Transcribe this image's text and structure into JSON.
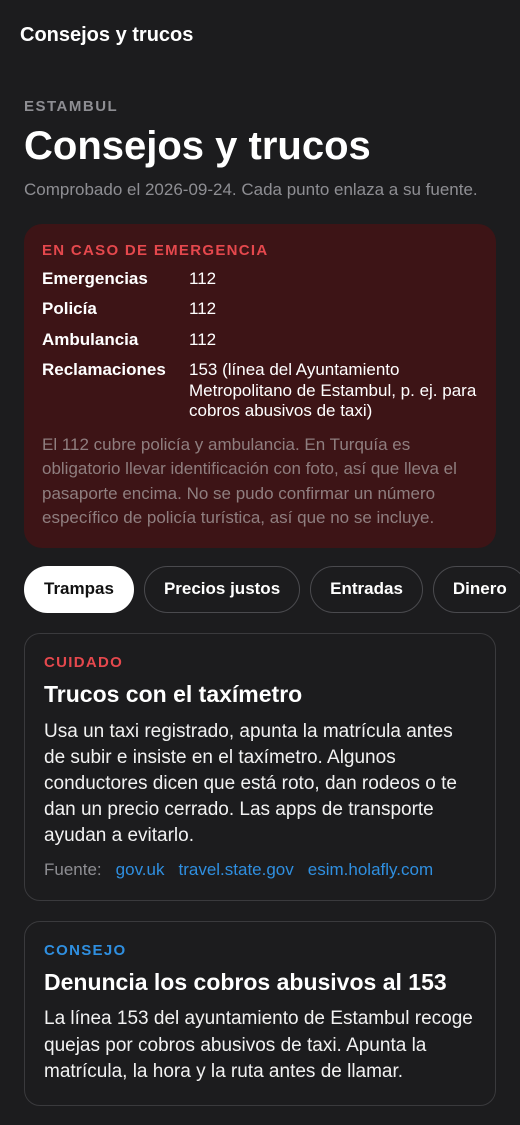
{
  "topbar": {
    "title": "Consejos y trucos"
  },
  "header": {
    "city": "ESTAMBUL",
    "title": "Consejos y trucos",
    "subtitle": "Comprobado el 2026-09-24. Cada punto enlaza a su fuente."
  },
  "emergency": {
    "title": "EN CASO DE EMERGENCIA",
    "rows": [
      {
        "label": "Emergencias",
        "value": "112"
      },
      {
        "label": "Policía",
        "value": "112"
      },
      {
        "label": "Ambulancia",
        "value": "112"
      },
      {
        "label": "Reclamaciones",
        "value": "153 (línea del Ayuntamiento Metropolitano de Estambul, p. ej. para cobros abusivos de taxi)"
      }
    ],
    "note": "El 112 cubre policía y ambulancia. En Turquía es obligatorio llevar identificación con foto, así que lleva el pasaporte encima. No se pudo confirmar un número específico de policía turística, así que no se incluye."
  },
  "tabs": [
    {
      "label": "Trampas",
      "active": true
    },
    {
      "label": "Precios justos",
      "active": false
    },
    {
      "label": "Entradas",
      "active": false
    },
    {
      "label": "Dinero",
      "active": false
    }
  ],
  "cards": [
    {
      "tag": "CUIDADO",
      "title": "Trucos con el taxímetro",
      "body": "Usa un taxi registrado, apunta la matrícula antes de subir e insiste en el taxímetro. Algunos conductores dicen que está roto, dan rodeos o te dan un precio cerrado. Las apps de transporte ayudan a evitarlo.",
      "sources_label": "Fuente:",
      "sources": [
        "gov.uk",
        "travel.state.gov",
        "esim.holafly.com"
      ]
    },
    {
      "tag": "CONSEJO",
      "title": "Denuncia los cobros abusivos al 153",
      "body": "La línea 153 del ayuntamiento de Estambul recoge quejas por cobros abusivos de taxi. Apunta la matrícula, la hora y la ruta antes de llamar."
    }
  ],
  "colors": {
    "background": "#1c1c1e",
    "emergency_bg": "#3d1416",
    "warn": "#e5484d",
    "tip": "#2f8fe0",
    "link": "#2f8fe0"
  }
}
